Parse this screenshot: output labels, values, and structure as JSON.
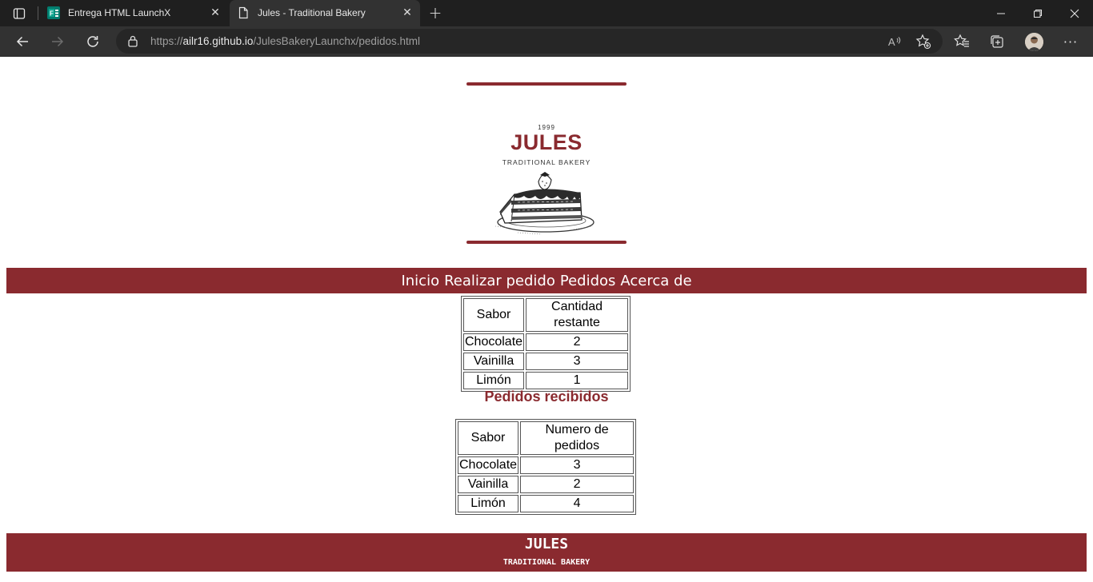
{
  "browser": {
    "tabs": [
      {
        "title": "Entrega HTML LaunchX",
        "favicon": "forms-icon"
      },
      {
        "title": "Jules - Traditional Bakery",
        "favicon": "page-icon",
        "active": true
      }
    ],
    "url_prefix": "https://",
    "url_domain": "ailr16.github.io",
    "url_path": "/JulesBakeryLaunchx/pedidos.html"
  },
  "logo": {
    "year": "1999",
    "name": "JULES",
    "tagline": "TRADITIONAL BAKERY",
    "accent_color": "#8a2a2f"
  },
  "nav": {
    "items": [
      "Inicio",
      "Realizar pedido",
      "Pedidos",
      "Acerca de"
    ]
  },
  "stock_table": {
    "headers": [
      "Sabor",
      "Cantidad restante"
    ],
    "rows": [
      [
        "Chocolate",
        "2"
      ],
      [
        "Vainilla",
        "3"
      ],
      [
        "Limón",
        "1"
      ]
    ]
  },
  "orders": {
    "heading": "Pedidos recibidos",
    "headers": [
      "Sabor",
      "Numero de pedidos"
    ],
    "rows": [
      [
        "Chocolate",
        "3"
      ],
      [
        "Vainilla",
        "2"
      ],
      [
        "Limón",
        "4"
      ]
    ]
  },
  "footer": {
    "name": "JULES",
    "tagline": "TRADITIONAL BAKERY"
  }
}
